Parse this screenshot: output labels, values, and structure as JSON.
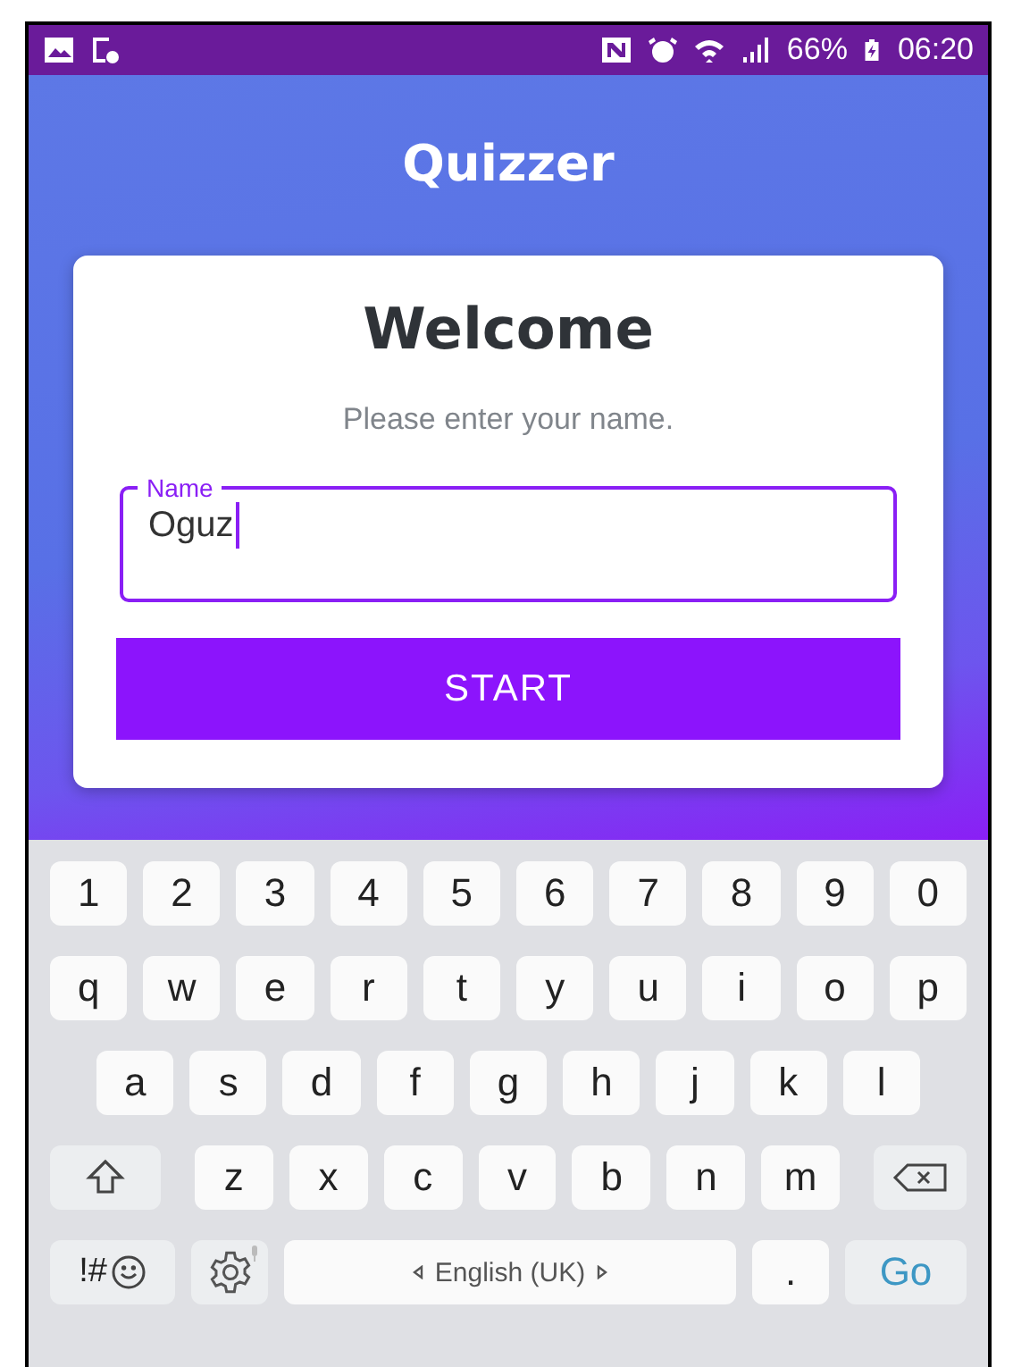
{
  "status_bar": {
    "battery": "66%",
    "time": "06:20"
  },
  "app": {
    "title": "Quizzer"
  },
  "card": {
    "heading": "Welcome",
    "prompt": "Please enter your name.",
    "name_field": {
      "label": "Name",
      "value": "Oguz",
      "focused": true
    },
    "start_button": "START"
  },
  "keyboard": {
    "rows": [
      {
        "keys": [
          {
            "kind": "char",
            "label": "1"
          },
          {
            "kind": "char",
            "label": "2"
          },
          {
            "kind": "char",
            "label": "3"
          },
          {
            "kind": "char",
            "label": "4"
          },
          {
            "kind": "char",
            "label": "5"
          },
          {
            "kind": "char",
            "label": "6"
          },
          {
            "kind": "char",
            "label": "7"
          },
          {
            "kind": "char",
            "label": "8"
          },
          {
            "kind": "char",
            "label": "9"
          },
          {
            "kind": "char",
            "label": "0"
          }
        ]
      },
      {
        "keys": [
          {
            "kind": "char",
            "label": "q"
          },
          {
            "kind": "char",
            "label": "w"
          },
          {
            "kind": "char",
            "label": "e"
          },
          {
            "kind": "char",
            "label": "r"
          },
          {
            "kind": "char",
            "label": "t"
          },
          {
            "kind": "char",
            "label": "y"
          },
          {
            "kind": "char",
            "label": "u"
          },
          {
            "kind": "char",
            "label": "i"
          },
          {
            "kind": "char",
            "label": "o"
          },
          {
            "kind": "char",
            "label": "p"
          }
        ]
      },
      {
        "keys": [
          {
            "kind": "char",
            "label": "a"
          },
          {
            "kind": "char",
            "label": "s"
          },
          {
            "kind": "char",
            "label": "d"
          },
          {
            "kind": "char",
            "label": "f"
          },
          {
            "kind": "char",
            "label": "g"
          },
          {
            "kind": "char",
            "label": "h"
          },
          {
            "kind": "char",
            "label": "j"
          },
          {
            "kind": "char",
            "label": "k"
          },
          {
            "kind": "char",
            "label": "l"
          }
        ]
      },
      {
        "keys": [
          {
            "kind": "shift"
          },
          {
            "kind": "char",
            "label": "z"
          },
          {
            "kind": "char",
            "label": "x"
          },
          {
            "kind": "char",
            "label": "c"
          },
          {
            "kind": "char",
            "label": "v"
          },
          {
            "kind": "char",
            "label": "b"
          },
          {
            "kind": "char",
            "label": "n"
          },
          {
            "kind": "char",
            "label": "m"
          },
          {
            "kind": "backspace"
          }
        ]
      },
      {
        "keys": [
          {
            "kind": "symbols",
            "label": "!#"
          },
          {
            "kind": "settings"
          },
          {
            "kind": "space",
            "label": "English (UK)"
          },
          {
            "kind": "char",
            "label": "."
          },
          {
            "kind": "action",
            "label": "Go"
          }
        ]
      }
    ]
  }
}
